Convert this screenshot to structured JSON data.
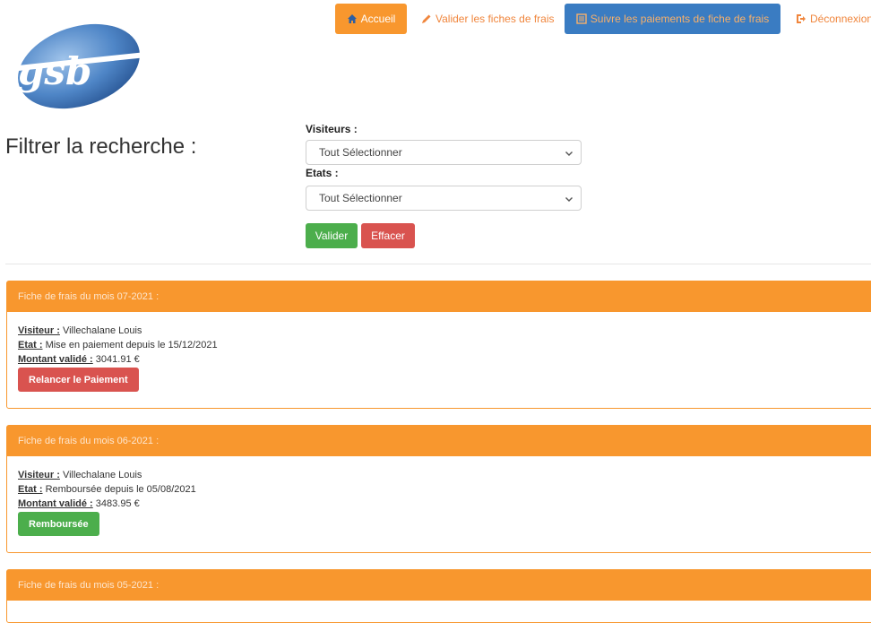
{
  "logo": {
    "text": "gsb"
  },
  "nav": {
    "accueil": "Accueil",
    "valider": "Valider les fiches de frais",
    "suivre": "Suivre les paiements de fiche de frais",
    "deconnexion": "Déconnexion"
  },
  "filter": {
    "title": "Filtrer la recherche :",
    "visiteurs_label": "Visiteurs :",
    "visiteurs_value": "Tout Sélectionner",
    "etats_label": "Etats :",
    "etats_value": "Tout Sélectionner",
    "valider": "Valider",
    "effacer": "Effacer"
  },
  "fiches": [
    {
      "header": "Fiche de frais du mois 07-2021 :",
      "visiteur_label": "Visiteur :",
      "visiteur": "Villechalane Louis",
      "etat_label": "Etat :",
      "etat": "Mise en paiement depuis le 15/12/2021",
      "montant_label": "Montant validé :",
      "montant": "3041.91 €",
      "action": "Relancer le Paiement"
    },
    {
      "header": "Fiche de frais du mois 06-2021 :",
      "visiteur_label": "Visiteur :",
      "visiteur": "Villechalane Louis",
      "etat_label": "Etat :",
      "etat": "Remboursée depuis le 05/08/2021",
      "montant_label": "Montant validé :",
      "montant": "3483.95 €",
      "action": "Remboursée"
    },
    {
      "header": "Fiche de frais du mois 05-2021 :"
    }
  ],
  "colors": {
    "orange": "#f8972e",
    "blue": "#3a7cc2",
    "green": "#4cae4c",
    "red": "#d9534f"
  }
}
